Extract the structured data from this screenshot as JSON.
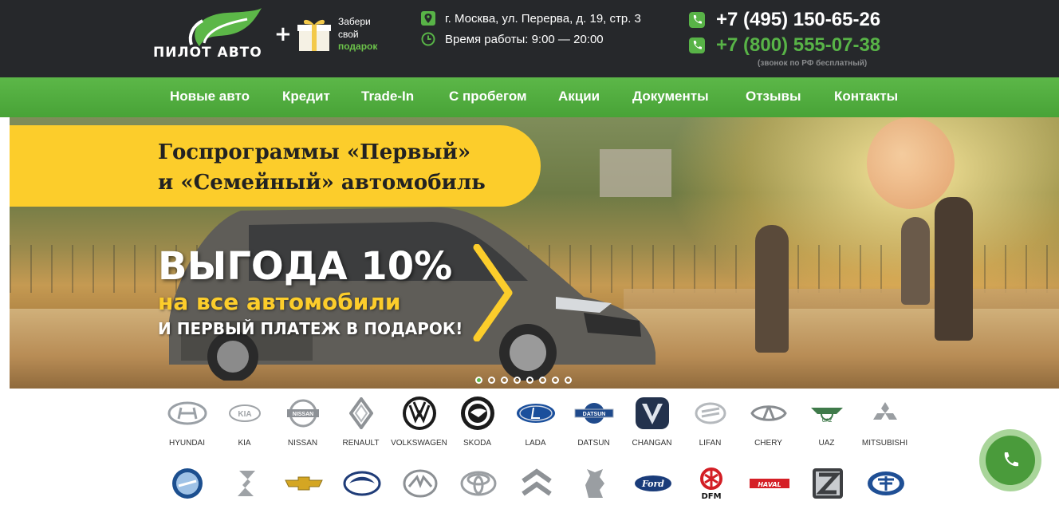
{
  "header": {
    "logo_text": "ПИЛОТ АВТО",
    "plus": "+",
    "gift": {
      "line1": "Забери",
      "line2": "свой",
      "line3": "подарок"
    },
    "address": "г. Москва, ул. Перерва, д. 19, стр. 3",
    "hours": "Время работы: 9:00 — 20:00",
    "phone1": "+7 (495) 150-65-26",
    "phone2": "+7 (800) 555-07-38",
    "phone_note": "(звонок по РФ бесплатный)",
    "colors": {
      "bg": "#26282b",
      "accent": "#58b347"
    }
  },
  "nav": {
    "items": [
      {
        "label": "Новые авто"
      },
      {
        "label": "Кредит"
      },
      {
        "label": "Trade-In"
      },
      {
        "label": "С пробегом"
      },
      {
        "label": "Акции"
      },
      {
        "label": "Документы"
      },
      {
        "label": "Отзывы"
      },
      {
        "label": "Контакты"
      }
    ]
  },
  "banner": {
    "ribbon_line1": "Госпрограммы «Первый»",
    "ribbon_line2": "и «Семейный» автомобиль",
    "headline": "ВЫГОДА 10%",
    "subline": "на все автомобили",
    "tagline": "И ПЕРВЫЙ ПЛАТЕЖ В ПОДАРОК!",
    "slides_total": 8,
    "active_slide": 1
  },
  "brands_row1": [
    {
      "name": "HYUNDAI",
      "icon": "hyundai-logo"
    },
    {
      "name": "KIA",
      "icon": "kia-logo"
    },
    {
      "name": "NISSAN",
      "icon": "nissan-logo"
    },
    {
      "name": "RENAULT",
      "icon": "renault-logo"
    },
    {
      "name": "VOLKSWAGEN",
      "icon": "volkswagen-logo"
    },
    {
      "name": "SKODA",
      "icon": "skoda-logo"
    },
    {
      "name": "LADA",
      "icon": "lada-logo"
    },
    {
      "name": "DATSUN",
      "icon": "datsun-logo"
    },
    {
      "name": "CHANGAN",
      "icon": "changan-logo"
    },
    {
      "name": "LIFAN",
      "icon": "lifan-logo"
    },
    {
      "name": "CHERY",
      "icon": "chery-logo"
    },
    {
      "name": "UAZ",
      "icon": "uaz-logo"
    },
    {
      "name": "MITSUBISHI",
      "icon": "mitsubishi-logo"
    }
  ],
  "brands_row2": [
    {
      "icon": "geely-logo"
    },
    {
      "icon": "suzuki-logo"
    },
    {
      "icon": "chevrolet-logo"
    },
    {
      "icon": "ssangyong-logo"
    },
    {
      "icon": "mazda-logo"
    },
    {
      "icon": "toyota-logo"
    },
    {
      "icon": "citroen-logo"
    },
    {
      "icon": "peugeot-logo"
    },
    {
      "icon": "ford-logo"
    },
    {
      "icon": "dfm-logo",
      "text": "DFM"
    },
    {
      "icon": "haval-logo",
      "text": "HAVAL"
    },
    {
      "icon": "zotye-logo"
    },
    {
      "icon": "faw-logo"
    }
  ],
  "call_button": {
    "icon": "phone-icon"
  }
}
